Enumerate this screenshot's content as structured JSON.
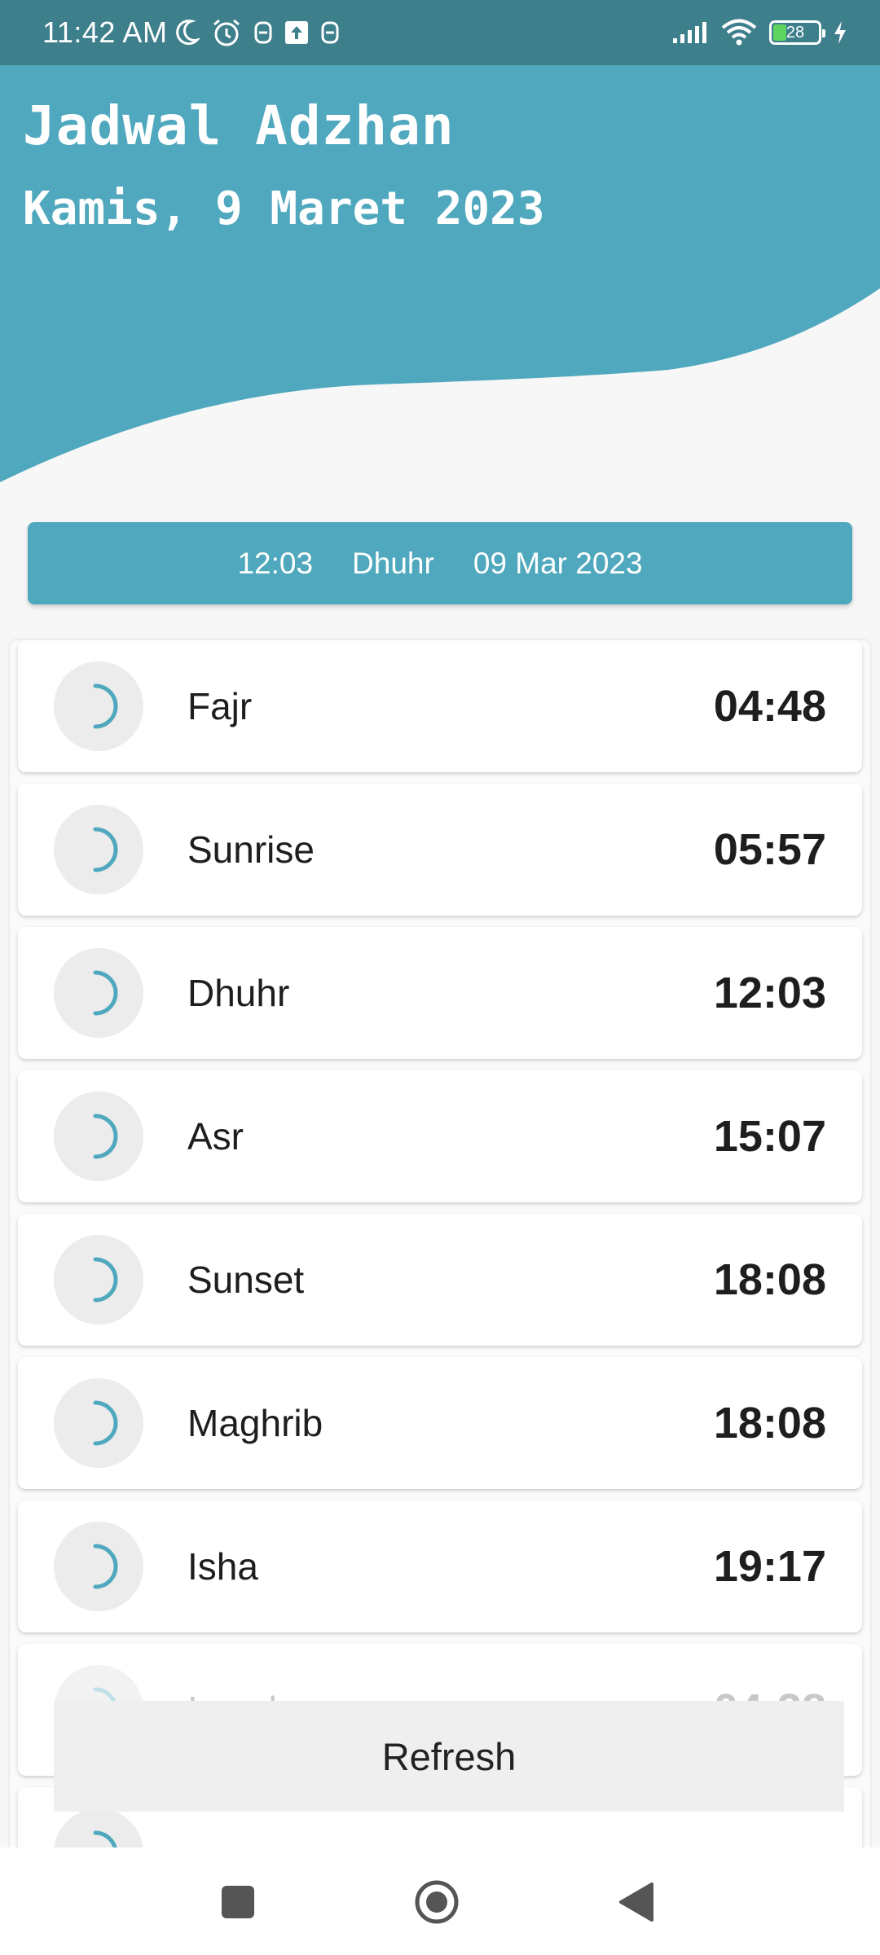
{
  "status_bar": {
    "time": "11:42 AM",
    "battery": "28",
    "left_icons": [
      "moon-icon",
      "alarm-icon",
      "app-notification-icon",
      "upload-icon",
      "app-notification-icon"
    ],
    "right_icons": [
      "signal-icon",
      "wifi-icon",
      "battery-icon",
      "charging-icon"
    ]
  },
  "header": {
    "title": "Jadwal Adzhan",
    "date": "Kamis, 9 Maret 2023"
  },
  "current": {
    "time": "12:03",
    "prayer": "Dhuhr",
    "date": "09 Mar 2023"
  },
  "prayers": [
    {
      "name": "Fajr",
      "time": "04:48"
    },
    {
      "name": "Sunrise",
      "time": "05:57"
    },
    {
      "name": "Dhuhr",
      "time": "12:03"
    },
    {
      "name": "Asr",
      "time": "15:07"
    },
    {
      "name": "Sunset",
      "time": "18:08"
    },
    {
      "name": "Maghrib",
      "time": "18:08"
    },
    {
      "name": "Isha",
      "time": "19:17"
    },
    {
      "name": "Imsak",
      "time": "04:38"
    }
  ],
  "actions": {
    "refresh_label": "Refresh"
  },
  "colors": {
    "accent": "#4fa8bd",
    "status_bar": "#3e7f8c",
    "moon": "#4fa8bd"
  },
  "nav": [
    "recent-apps-icon",
    "home-icon",
    "back-icon"
  ]
}
